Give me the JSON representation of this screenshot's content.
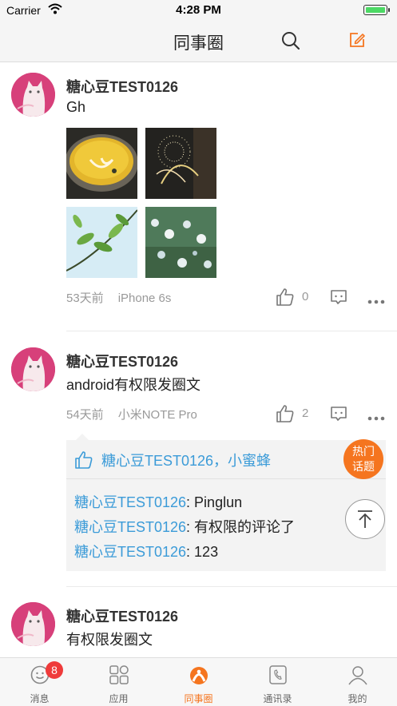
{
  "status_bar": {
    "carrier": "Carrier",
    "time": "4:28 PM"
  },
  "nav": {
    "title": "同事圈"
  },
  "posts": [
    {
      "author": "糖心豆TEST0126",
      "content": "Gh",
      "time": "53天前",
      "device": "iPhone 6s",
      "likes": "0"
    },
    {
      "author": "糖心豆TEST0126",
      "content": "android有权限发圈文",
      "time": "54天前",
      "device": "小米NOTE Pro",
      "likes": "2",
      "liked_by": "糖心豆TEST0126，小蜜蜂",
      "comments": [
        {
          "author": "糖心豆TEST0126",
          "text": ": Pinglun"
        },
        {
          "author": "糖心豆TEST0126",
          "text": ": 有权限的评论了"
        },
        {
          "author": "糖心豆TEST0126",
          "text": ": 123"
        }
      ]
    },
    {
      "author": "糖心豆TEST0126",
      "content": "有权限发圈文"
    }
  ],
  "hot_topic": {
    "line1": "热门",
    "line2": "话题"
  },
  "tabs": [
    {
      "label": "消息",
      "badge": "8"
    },
    {
      "label": "应用"
    },
    {
      "label": "同事圈"
    },
    {
      "label": "通讯录"
    },
    {
      "label": "我的"
    }
  ],
  "colors": {
    "accent": "#f5751f",
    "link": "#3b9bd8",
    "badge": "#ef3b3b"
  }
}
